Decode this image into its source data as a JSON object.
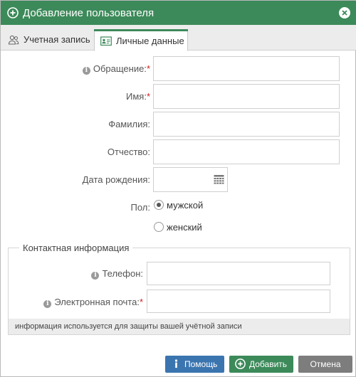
{
  "dialog": {
    "title": "Добавление пользователя"
  },
  "tabs": [
    {
      "label": "Учетная запись"
    },
    {
      "label": "Личные данные"
    }
  ],
  "form": {
    "salutation": {
      "label": "Обращение:",
      "required_mark": "*",
      "value": ""
    },
    "first_name": {
      "label": "Имя:",
      "required_mark": "*",
      "value": ""
    },
    "last_name": {
      "label": "Фамилия:",
      "value": ""
    },
    "middle_name": {
      "label": "Отчество:",
      "value": ""
    },
    "birth_date": {
      "label": "Дата рождения:",
      "value": ""
    },
    "gender": {
      "label": "Пол:",
      "options": [
        {
          "label": "мужской",
          "checked": true
        },
        {
          "label": "женский",
          "checked": false
        }
      ]
    }
  },
  "contact": {
    "legend": "Контактная информация",
    "phone": {
      "label": "Телефон:",
      "value": ""
    },
    "email": {
      "label": "Электронная почта:",
      "required_mark": "*",
      "value": ""
    },
    "note": "информация используется для защиты вашей учётной записи"
  },
  "buttons": {
    "help": "Помощь",
    "add": "Добавить",
    "cancel": "Отмена"
  },
  "colors": {
    "header": "#3c8a5a",
    "help_button": "#3b75b0",
    "add_button": "#3c8a5a",
    "cancel_button": "#7d7d7d",
    "required": "#cc2222"
  }
}
